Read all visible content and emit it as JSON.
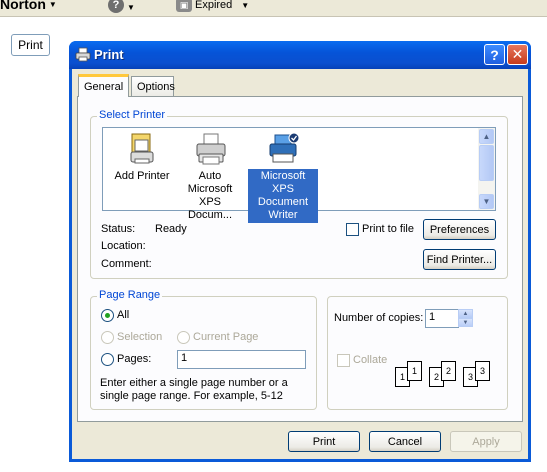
{
  "browser_toolbar": {
    "norton_label": "Norton",
    "help_icon": "question-mark",
    "expired_label": "Expired"
  },
  "page": {
    "print_button": "Print"
  },
  "dialog": {
    "title": "Print",
    "help_button": "?",
    "close_button": "✕",
    "tabs": [
      {
        "label": "General",
        "active": true
      },
      {
        "label": "Options",
        "active": false
      }
    ],
    "select_printer": {
      "group_label": "Select Printer",
      "printers": [
        {
          "label": "Add Printer",
          "selected": false,
          "icon": "add-printer-icon"
        },
        {
          "label": "Auto Microsoft XPS Docum...",
          "selected": false,
          "icon": "printer-icon"
        },
        {
          "label": "Microsoft XPS Document Writer",
          "selected": true,
          "icon": "xps-printer-icon"
        }
      ],
      "status_label": "Status:",
      "status_value": "Ready",
      "location_label": "Location:",
      "location_value": "",
      "comment_label": "Comment:",
      "comment_value": "",
      "print_to_file_label": "Print to file",
      "print_to_file_checked": false,
      "preferences_button": "Preferences",
      "find_printer_button": "Find Printer..."
    },
    "page_range": {
      "group_label": "Page Range",
      "all_label": "All",
      "selection_label": "Selection",
      "current_page_label": "Current Page",
      "pages_label": "Pages:",
      "pages_value": "1",
      "hint": "Enter either a single page number or a single page range.  For example, 5-12",
      "selected": "All"
    },
    "copies": {
      "number_label": "Number of copies:",
      "number_value": "1",
      "collate_label": "Collate",
      "collate_checked": false,
      "collate_pages": [
        "1",
        "1",
        "2",
        "2",
        "3",
        "3"
      ]
    },
    "buttons": {
      "print": "Print",
      "cancel": "Cancel",
      "apply": "Apply"
    }
  }
}
